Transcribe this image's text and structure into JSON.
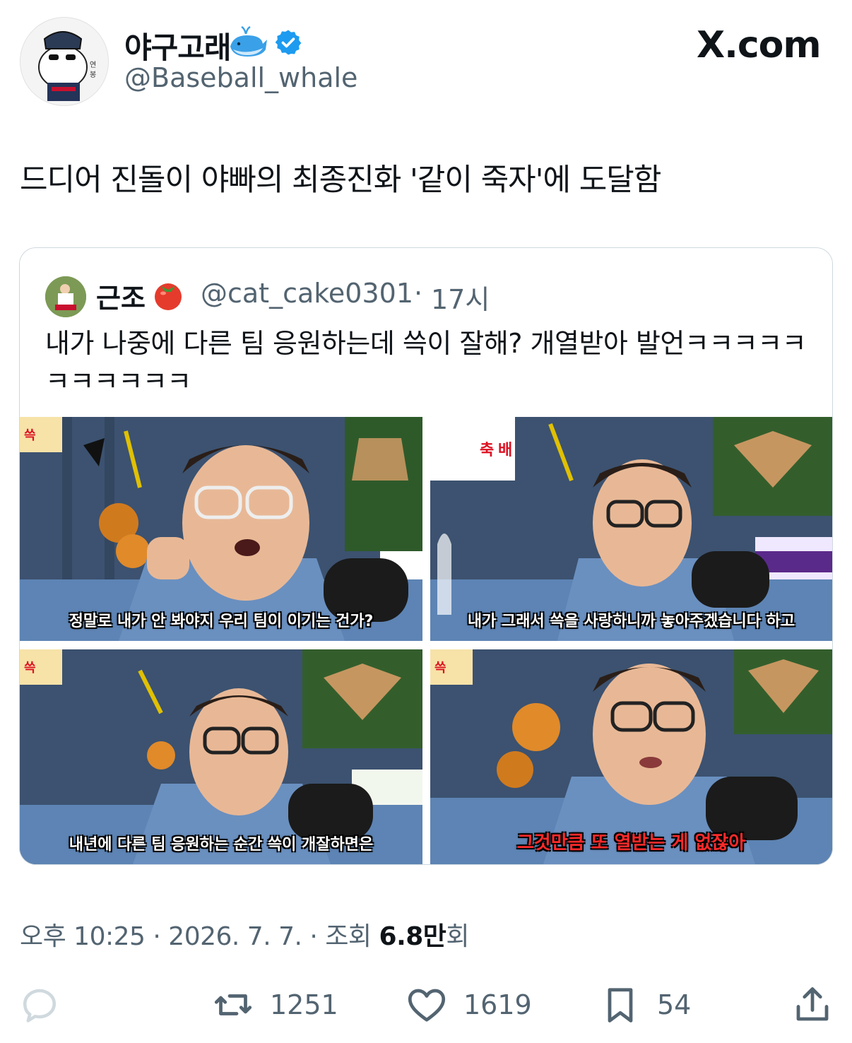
{
  "author": {
    "display_name": "야구고래",
    "handle": "@Baseball_whale"
  },
  "brand": "X.com",
  "tweet": {
    "text": "드디어 진돌이 야빠의 최종진화 '같이 죽자'에 도달함"
  },
  "quote": {
    "name": "근조",
    "handle": "@cat_cake0301",
    "separator": "·",
    "time": "17시",
    "text": "내가 나중에 다른 팀 응원하는데 쓱이 잘해? 개열받아 발언ㅋㅋㅋㅋㅋㅋㅋㅋㅋㅋㅋ",
    "images": [
      {
        "subtitle": "정말로 내가 안 봐야지 우리 팀이 이기는 건가?"
      },
      {
        "subtitle": "내가 그래서 쓱을 사랑하니까 놓아주겠습니다 하고"
      },
      {
        "subtitle": "내년에 다른 팀 응원하는 순간 쓱이 개잘하면은"
      },
      {
        "subtitle": "그것만큼 또 열받는 게 없잖아"
      }
    ]
  },
  "meta": {
    "time": "오후 10:25",
    "dot1": "·",
    "date": "2026. 7. 7.",
    "dot2": "·",
    "views_label": "조회",
    "views_value": "6.8만",
    "views_suffix": "회"
  },
  "actions": {
    "retweets": "1251",
    "likes": "1619",
    "bookmarks": "54"
  },
  "colors": {
    "verified": "#1d9bf0",
    "secondary_text": "#536471",
    "border": "#cfd9de"
  }
}
